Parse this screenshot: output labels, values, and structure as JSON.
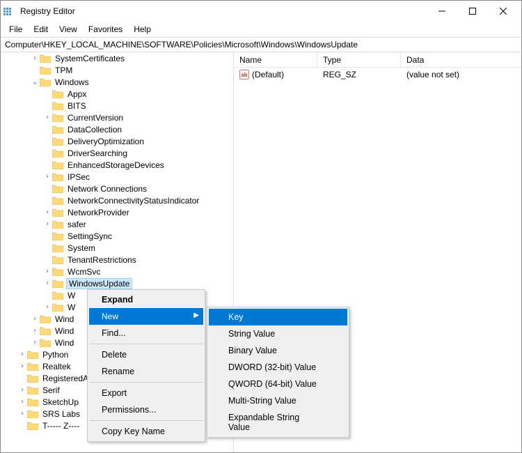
{
  "window": {
    "title": "Registry Editor"
  },
  "menu": {
    "file": "File",
    "edit": "Edit",
    "view": "View",
    "favorites": "Favorites",
    "help": "Help"
  },
  "address": "Computer\\HKEY_LOCAL_MACHINE\\SOFTWARE\\Policies\\Microsoft\\Windows\\WindowsUpdate",
  "values_header": {
    "name": "Name",
    "type": "Type",
    "data": "Data"
  },
  "values": [
    {
      "name": "(Default)",
      "type": "REG_SZ",
      "data": "(value not set)"
    }
  ],
  "tree": {
    "systemcertificates": "SystemCertificates",
    "tpm": "TPM",
    "windows": "Windows",
    "appx": "Appx",
    "bits": "BITS",
    "currentversion": "CurrentVersion",
    "datacollection": "DataCollection",
    "deliveryoptimization": "DeliveryOptimization",
    "driversearching": "DriverSearching",
    "enhancedstoragedevices": "EnhancedStorageDevices",
    "ipsec": "IPSec",
    "networkconnections": "Network Connections",
    "networkconnectivity": "NetworkConnectivityStatusIndicator",
    "networkprovider": "NetworkProvider",
    "safer": "safer",
    "settingsync": "SettingSync",
    "system": "System",
    "tenantrestrictions": "TenantRestrictions",
    "wcmsvc": "WcmSvc",
    "windowsupdate": "WindowsUpdate",
    "w_cut": "W",
    "w_cut2": "W",
    "winda": "Wind",
    "windb": "Wind",
    "windc": "Wind",
    "python": "Python",
    "realtek": "Realtek",
    "registeredapps": "RegisteredA",
    "serif": "Serif",
    "sketchup": "SketchUp",
    "srslabs": "SRS Labs",
    "trustzone_cut": "T----- Z----"
  },
  "context_menu": {
    "expand": "Expand",
    "new": "New",
    "find": "Find...",
    "delete": "Delete",
    "rename": "Rename",
    "export": "Export",
    "permissions": "Permissions...",
    "copykeyname": "Copy Key Name"
  },
  "submenu": {
    "key": "Key",
    "string": "String Value",
    "binary": "Binary Value",
    "dword": "DWORD (32-bit) Value",
    "qword": "QWORD (64-bit) Value",
    "multistring": "Multi-String Value",
    "expandable": "Expandable String Value"
  }
}
